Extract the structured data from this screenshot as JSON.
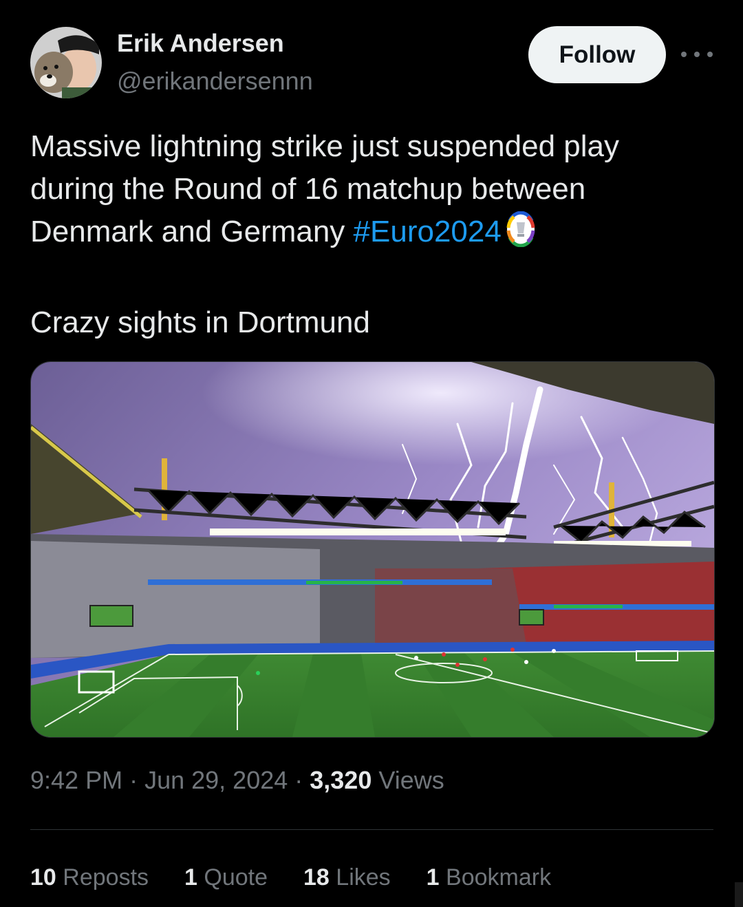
{
  "author": {
    "name": "Erik Andersen",
    "handle": "@erikandersennn"
  },
  "actions": {
    "follow_label": "Follow",
    "more_icon": "more-horizontal-icon"
  },
  "tweet": {
    "text_before_hashtag": "Massive lightning strike just suspended play during the Round of 16 matchup between Denmark and Germany ",
    "hashtag": "#Euro2024",
    "hashtag_emoji_icon": "euro2024-trophy-icon",
    "second_paragraph": "Crazy sights in Dortmund"
  },
  "media": {
    "icon": "stadium-lightning-photo"
  },
  "meta": {
    "time": "9:42 PM",
    "separator": " · ",
    "date": "Jun 29, 2024",
    "views_count": "3,320",
    "views_label": " Views"
  },
  "stats": {
    "reposts_count": "10",
    "reposts_label": "Reposts",
    "quotes_count": "1",
    "quotes_label": "Quote",
    "likes_count": "18",
    "likes_label": "Likes",
    "bookmarks_count": "1",
    "bookmarks_label": "Bookmark"
  },
  "colors": {
    "background": "#000000",
    "text": "#e7e9ea",
    "secondary": "#71767b",
    "link": "#1d9bf0",
    "follow_bg": "#eff3f4"
  }
}
